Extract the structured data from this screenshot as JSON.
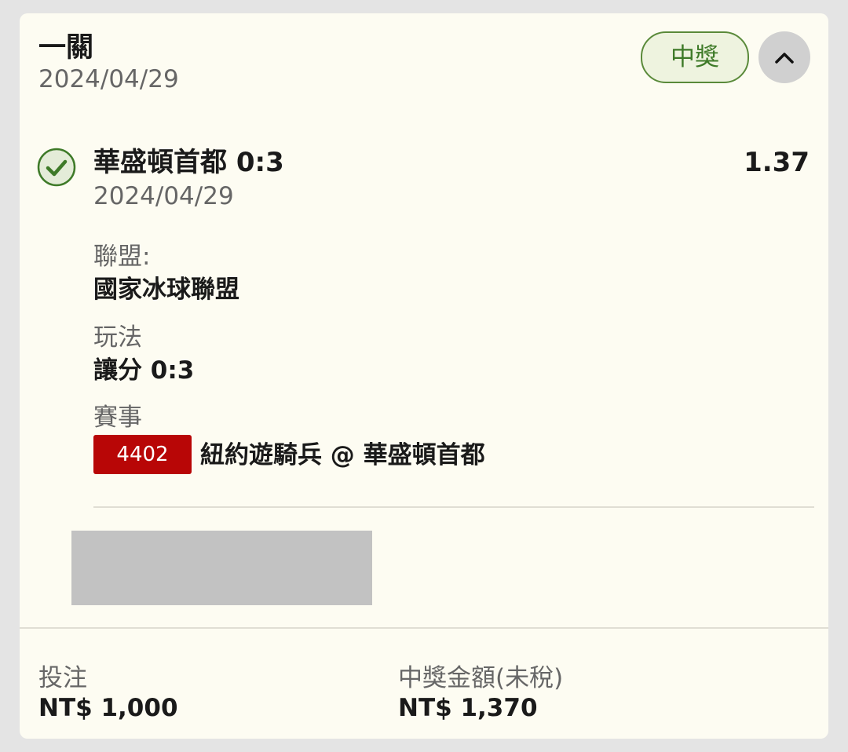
{
  "header": {
    "title": "一關",
    "date": "2024/04/29",
    "status": "中獎",
    "collapse_icon": "chevron-up-icon"
  },
  "selection": {
    "status_icon": "check-circle-icon",
    "title": "華盛頓首都 0:3",
    "odds": "1.37",
    "date": "2024/04/29",
    "league_label": "聯盟:",
    "league_value": "國家冰球聯盟",
    "play_label": "玩法",
    "play_value": "讓分 0:3",
    "event_label": "賽事",
    "event_code": "4402",
    "event_name": "紐約遊騎兵 @ 華盛頓首都"
  },
  "footer": {
    "stake_label": "投注",
    "stake_value": "NT$ 1,000",
    "payout_label": "中獎金額(未稅)",
    "payout_value": "NT$ 1,370"
  },
  "colors": {
    "card_bg": "#fdfcf2",
    "win_green": "#3e7a28",
    "event_red": "#b80606"
  }
}
